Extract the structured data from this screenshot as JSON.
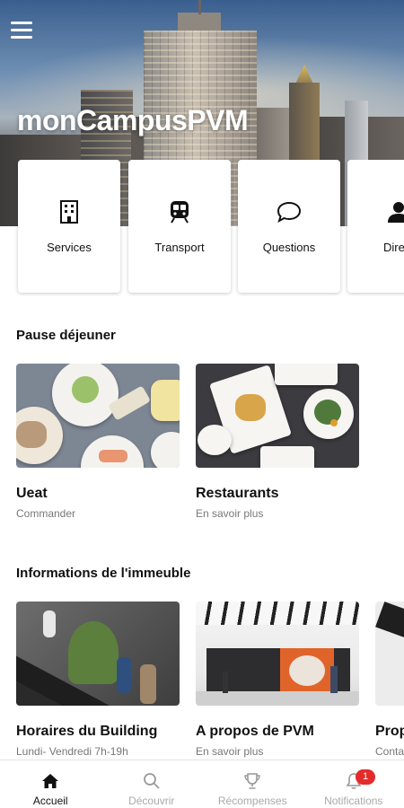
{
  "app": {
    "title": "monCampusPVM"
  },
  "quick_actions": [
    {
      "label": "Services",
      "icon": "building-icon"
    },
    {
      "label": "Transport",
      "icon": "train-icon"
    },
    {
      "label": "Questions",
      "icon": "chat-bubble-icon"
    },
    {
      "label": "Direct",
      "icon": "person-icon"
    }
  ],
  "lunch": {
    "title": "Pause déjeuner",
    "cards": [
      {
        "title": "Ueat",
        "subtitle": "Commander"
      },
      {
        "title": "Restaurants",
        "subtitle": "En savoir plus"
      }
    ]
  },
  "building": {
    "title": "Informations de l'immeuble",
    "cards": [
      {
        "title": "Horaires du Building",
        "subtitle": "Lundi- Vendredi 7h-19h"
      },
      {
        "title": "A propos de PVM",
        "subtitle": "En savoir plus"
      },
      {
        "title": "Prop",
        "subtitle": "Conta"
      }
    ]
  },
  "bottom_nav": [
    {
      "label": "Accueil",
      "icon": "home-icon",
      "active": true
    },
    {
      "label": "Découvrir",
      "icon": "search-icon",
      "active": false
    },
    {
      "label": "Récompenses",
      "icon": "trophy-icon",
      "active": false
    },
    {
      "label": "Notifications",
      "icon": "bell-icon",
      "active": false,
      "badge": "1"
    }
  ],
  "colors": {
    "badge": "#e52a2a",
    "inactive_nav": "#aaaaaa",
    "text": "#111111"
  }
}
